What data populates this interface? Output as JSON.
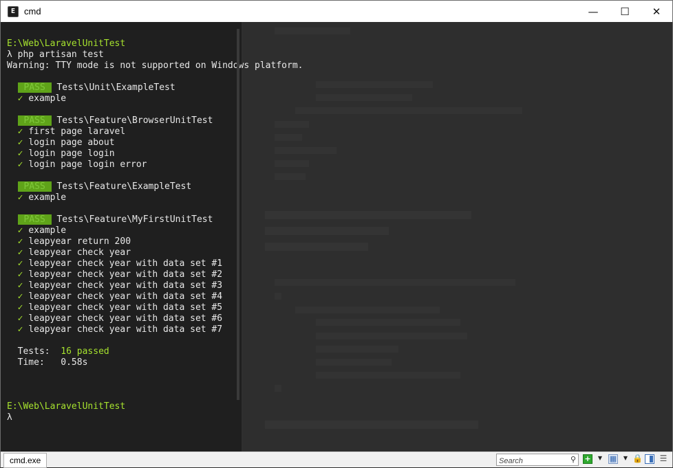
{
  "window": {
    "title": "cmd",
    "app_icon_glyph": "E",
    "controls": {
      "minimize": "—",
      "maximize": "☐",
      "close": "✕"
    }
  },
  "terminal": {
    "lines": [
      {
        "kind": "prompt-path",
        "text": "E:\\Web\\LaravelUnitTest"
      },
      {
        "kind": "command",
        "text": "λ php artisan test"
      },
      {
        "kind": "text",
        "text": "Warning: TTY mode is not supported on Windows platform."
      },
      {
        "kind": "blank",
        "text": ""
      },
      {
        "kind": "suite",
        "badge": "PASS",
        "text": "Tests\\Unit\\ExampleTest"
      },
      {
        "kind": "test",
        "check": "✓",
        "text": "example"
      },
      {
        "kind": "blank",
        "text": ""
      },
      {
        "kind": "suite",
        "badge": "PASS",
        "text": "Tests\\Feature\\BrowserUnitTest"
      },
      {
        "kind": "test",
        "check": "✓",
        "text": "first page laravel"
      },
      {
        "kind": "test",
        "check": "✓",
        "text": "login page about"
      },
      {
        "kind": "test",
        "check": "✓",
        "text": "login page login"
      },
      {
        "kind": "test",
        "check": "✓",
        "text": "login page login error"
      },
      {
        "kind": "blank",
        "text": ""
      },
      {
        "kind": "suite",
        "badge": "PASS",
        "text": "Tests\\Feature\\ExampleTest"
      },
      {
        "kind": "test",
        "check": "✓",
        "text": "example"
      },
      {
        "kind": "blank",
        "text": ""
      },
      {
        "kind": "suite",
        "badge": "PASS",
        "text": "Tests\\Feature\\MyFirstUnitTest"
      },
      {
        "kind": "test",
        "check": "✓",
        "text": "example"
      },
      {
        "kind": "test",
        "check": "✓",
        "text": "leapyear return 200"
      },
      {
        "kind": "test",
        "check": "✓",
        "text": "leapyear check year"
      },
      {
        "kind": "test",
        "check": "✓",
        "text": "leapyear check year with data set #1"
      },
      {
        "kind": "test",
        "check": "✓",
        "text": "leapyear check year with data set #2"
      },
      {
        "kind": "test",
        "check": "✓",
        "text": "leapyear check year with data set #3"
      },
      {
        "kind": "test",
        "check": "✓",
        "text": "leapyear check year with data set #4"
      },
      {
        "kind": "test",
        "check": "✓",
        "text": "leapyear check year with data set #5"
      },
      {
        "kind": "test",
        "check": "✓",
        "text": "leapyear check year with data set #6"
      },
      {
        "kind": "test",
        "check": "✓",
        "text": "leapyear check year with data set #7"
      },
      {
        "kind": "blank",
        "text": ""
      },
      {
        "kind": "summary",
        "label": "  Tests:  ",
        "value": "16 passed"
      },
      {
        "kind": "summary-plain",
        "label": "  Time:   ",
        "value": "0.58s"
      },
      {
        "kind": "blank",
        "text": ""
      },
      {
        "kind": "blank",
        "text": ""
      },
      {
        "kind": "blank",
        "text": ""
      },
      {
        "kind": "prompt-path",
        "text": "E:\\Web\\LaravelUnitTest"
      },
      {
        "kind": "command",
        "text": "λ"
      }
    ]
  },
  "statusbar": {
    "tab_label": "cmd.exe",
    "search_placeholder": "Search",
    "icons": [
      "plus-icon",
      "dropdown-icon",
      "panel-icon",
      "dropdown-icon",
      "lock-icon",
      "layout-icon",
      "list-icon"
    ]
  },
  "colors": {
    "pass_badge": "#5fa319",
    "accent_green": "#a6e22e",
    "terminal_bg": "#1f1f1f"
  }
}
